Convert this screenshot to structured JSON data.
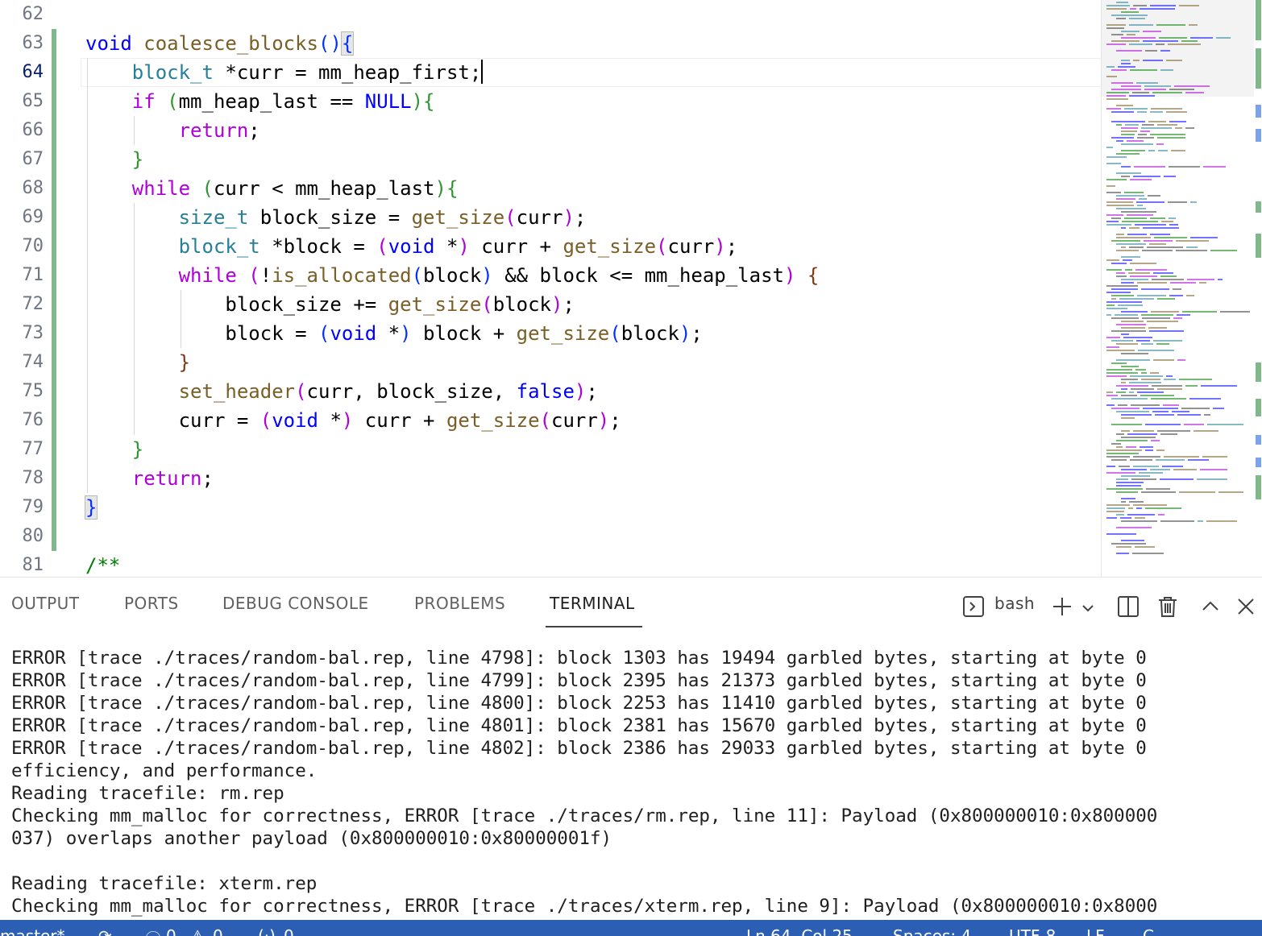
{
  "editor": {
    "line_numbers": [
      "62",
      "63",
      "64",
      "65",
      "66",
      "67",
      "68",
      "69",
      "70",
      "71",
      "72",
      "73",
      "74",
      "75",
      "76",
      "77",
      "78",
      "79",
      "80",
      "81"
    ],
    "active_line": "64"
  },
  "panel": {
    "tabs": [
      "OUTPUT",
      "PORTS",
      "DEBUG CONSOLE",
      "PROBLEMS",
      "TERMINAL"
    ],
    "active_tab": "TERMINAL",
    "shell_name": "bash"
  },
  "terminal": {
    "lines": [
      "ERROR [trace ./traces/random-bal.rep, line 4798]: block 1303 has 19494 garbled bytes, starting at byte 0",
      "ERROR [trace ./traces/random-bal.rep, line 4799]: block 2395 has 21373 garbled bytes, starting at byte 0",
      "ERROR [trace ./traces/random-bal.rep, line 4800]: block 2253 has 11410 garbled bytes, starting at byte 0",
      "ERROR [trace ./traces/random-bal.rep, line 4801]: block 2381 has 15670 garbled bytes, starting at byte 0",
      "ERROR [trace ./traces/random-bal.rep, line 4802]: block 2386 has 29033 garbled bytes, starting at byte 0",
      "efficiency, and performance.",
      "Reading tracefile: rm.rep",
      "Checking mm_malloc for correctness, ERROR [trace ./traces/rm.rep, line 11]: Payload (0x800000010:0x800000",
      "037) overlaps another payload (0x800000010:0x80000001f)",
      "",
      "Reading tracefile: xterm.rep",
      "Checking mm_malloc for correctness, ERROR [trace ./traces/xterm.rep, line 9]: Payload (0x800000010:0x8000"
    ]
  },
  "statusbar": {
    "branch": "master*",
    "errors": "0",
    "warnings": "0",
    "ports": "0",
    "cursor_position": "Ln 64, Col 25",
    "indentation": "Spaces: 4",
    "encoding": "UTF-8",
    "eol": "LF",
    "language": "C"
  },
  "colors": {
    "status_bar": "#2c5fb4",
    "keyword": "#0000ff",
    "control": "#af00db",
    "type": "#267f99",
    "function": "#795e26",
    "comment": "#008000",
    "git_added": "#81b88b"
  },
  "icons": [
    "terminal-icon",
    "plus-icon",
    "chevron-down-icon",
    "split-icon",
    "trash-icon",
    "chevron-up-icon",
    "close-icon",
    "sync-icon",
    "error-icon",
    "warning-icon",
    "broadcast-icon"
  ]
}
